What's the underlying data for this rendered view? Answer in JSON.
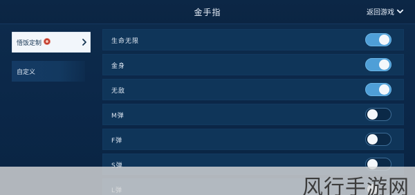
{
  "header": {
    "title": "金手指",
    "back_label": "返回游戏"
  },
  "sidebar": {
    "items": [
      {
        "label": "悟饭定制",
        "active": true
      },
      {
        "label": "自定义",
        "active": false
      }
    ]
  },
  "settings": {
    "rows": [
      {
        "label": "生命无限",
        "enabled": true
      },
      {
        "label": "金身",
        "enabled": true
      },
      {
        "label": "无敌",
        "enabled": true
      },
      {
        "label": "M弹",
        "enabled": false
      },
      {
        "label": "F弹",
        "enabled": false
      },
      {
        "label": "S弹",
        "enabled": false
      },
      {
        "label": "L弹",
        "enabled": false
      }
    ]
  },
  "watermark": {
    "text": "风行手游网"
  },
  "colors": {
    "accent": "#4f9fd7",
    "background": "#0b2543",
    "row": "#0f3559"
  }
}
